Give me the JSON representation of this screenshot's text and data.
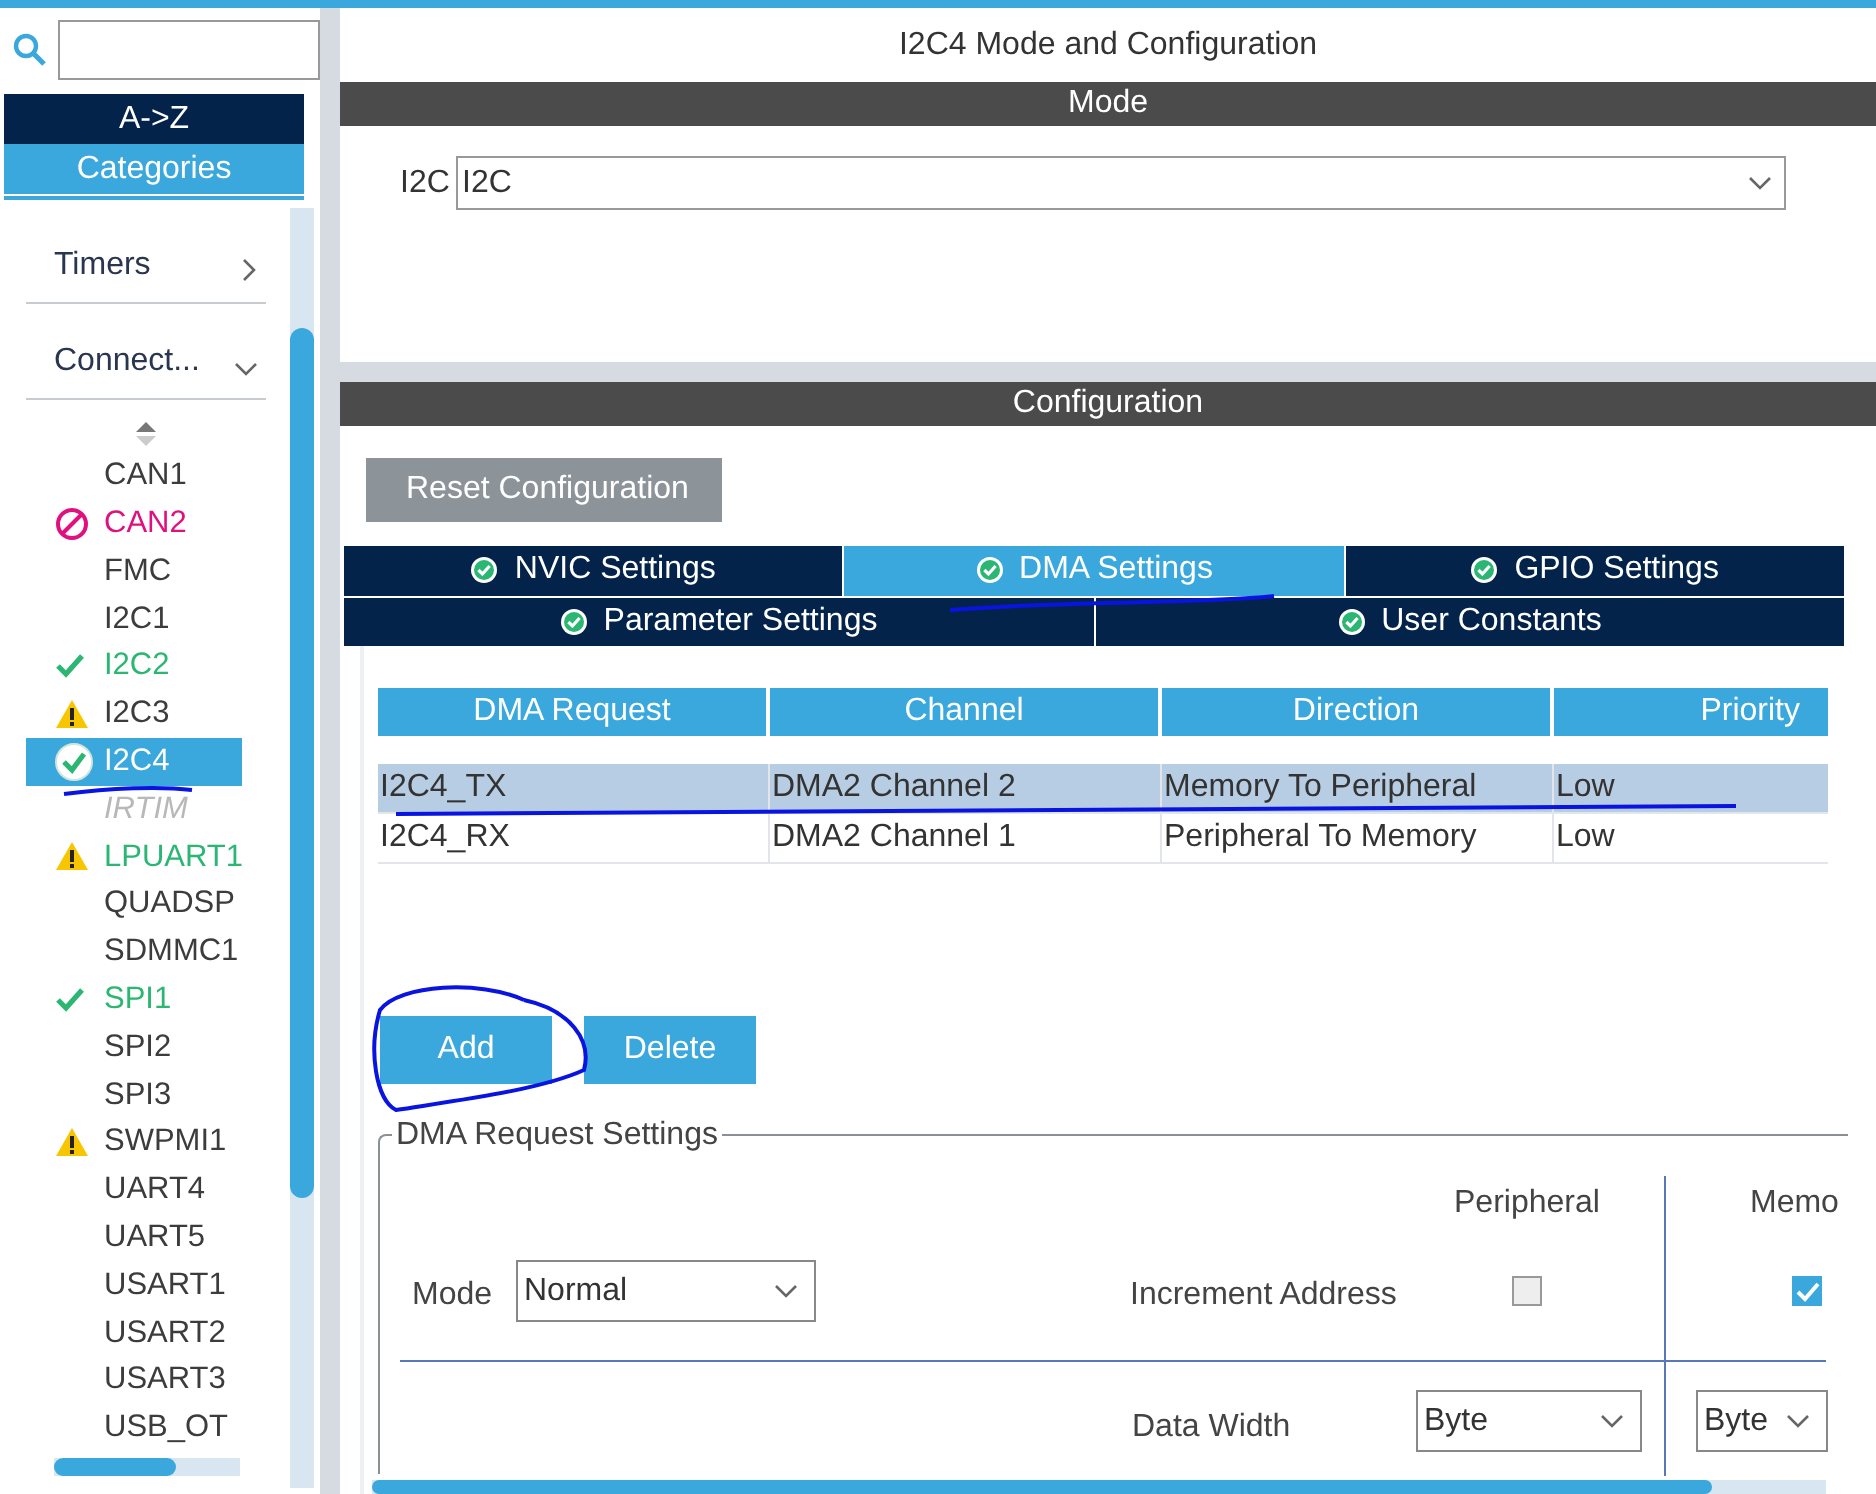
{
  "sidebar": {
    "sort_tabs": [
      {
        "label": "A->Z",
        "selected": false
      },
      {
        "label": "Categories",
        "selected": true
      }
    ],
    "categories": [
      {
        "label": "Timers",
        "expanded": false
      },
      {
        "label": "Connect...",
        "expanded": true
      }
    ],
    "peripherals": [
      {
        "label": "CAN1",
        "kind": "none",
        "color": "#3c3c3c",
        "selected": false,
        "disabled": false
      },
      {
        "label": "CAN2",
        "kind": "error",
        "color": "#e0107e",
        "selected": false,
        "disabled": false
      },
      {
        "label": "FMC",
        "kind": "none",
        "color": "#3c3c3c",
        "selected": false,
        "disabled": false
      },
      {
        "label": "I2C1",
        "kind": "none",
        "color": "#3c3c3c",
        "selected": false,
        "disabled": false
      },
      {
        "label": "I2C2",
        "kind": "ok",
        "color": "#2bb673",
        "selected": false,
        "disabled": false
      },
      {
        "label": "I2C3",
        "kind": "warning",
        "color": "#3c3c3c",
        "selected": false,
        "disabled": false
      },
      {
        "label": "I2C4",
        "kind": "ok",
        "color": "#ffffff",
        "selected": true,
        "disabled": false
      },
      {
        "label": "IRTIM",
        "kind": "none",
        "color": "#b8b8b8",
        "selected": false,
        "disabled": true
      },
      {
        "label": "LPUART1",
        "kind": "warning",
        "color": "#2bb673",
        "selected": false,
        "disabled": false
      },
      {
        "label": "QUADSP",
        "kind": "none",
        "color": "#3c3c3c",
        "selected": false,
        "disabled": false
      },
      {
        "label": "SDMMC1",
        "kind": "none",
        "color": "#3c3c3c",
        "selected": false,
        "disabled": false
      },
      {
        "label": "SPI1",
        "kind": "ok",
        "color": "#2bb673",
        "selected": false,
        "disabled": false
      },
      {
        "label": "SPI2",
        "kind": "none",
        "color": "#3c3c3c",
        "selected": false,
        "disabled": false
      },
      {
        "label": "SPI3",
        "kind": "none",
        "color": "#3c3c3c",
        "selected": false,
        "disabled": false
      },
      {
        "label": "SWPMI1",
        "kind": "warning",
        "color": "#3c3c3c",
        "selected": false,
        "disabled": false
      },
      {
        "label": "UART4",
        "kind": "none",
        "color": "#3c3c3c",
        "selected": false,
        "disabled": false
      },
      {
        "label": "UART5",
        "kind": "none",
        "color": "#3c3c3c",
        "selected": false,
        "disabled": false
      },
      {
        "label": "USART1",
        "kind": "none",
        "color": "#3c3c3c",
        "selected": false,
        "disabled": false
      },
      {
        "label": "USART2",
        "kind": "none",
        "color": "#3c3c3c",
        "selected": false,
        "disabled": false
      },
      {
        "label": "USART3",
        "kind": "none",
        "color": "#3c3c3c",
        "selected": false,
        "disabled": false
      },
      {
        "label": "USB_OT",
        "kind": "none",
        "color": "#3c3c3c",
        "selected": false,
        "disabled": false
      }
    ]
  },
  "title": "I2C4 Mode and Configuration",
  "mode": {
    "heading": "Mode",
    "label": "I2C",
    "value": "I2C"
  },
  "configuration": {
    "heading": "Configuration",
    "reset_button": "Reset Configuration",
    "tabs": [
      [
        {
          "label": "NVIC Settings",
          "selected": false
        },
        {
          "label": "DMA Settings",
          "selected": true
        },
        {
          "label": "GPIO Settings",
          "selected": false
        }
      ],
      [
        {
          "label": "Parameter Settings",
          "selected": false
        },
        {
          "label": "User Constants",
          "selected": false
        }
      ]
    ],
    "table": {
      "columns": [
        "DMA Request",
        "Channel",
        "Direction",
        "Priority"
      ],
      "rows": [
        {
          "cells": [
            "I2C4_TX",
            "DMA2 Channel 2",
            "Memory To Peripheral",
            "Low"
          ],
          "selected": true
        },
        {
          "cells": [
            "I2C4_RX",
            "DMA2 Channel 1",
            "Peripheral To Memory",
            "Low"
          ],
          "selected": false
        }
      ]
    },
    "buttons": [
      "Add",
      "Delete"
    ],
    "request_settings": {
      "title": "DMA Request Settings",
      "mode_label": "Mode",
      "mode_value": "Normal",
      "peripheral_heading": "Peripheral",
      "memory_heading": "Memo",
      "increment_label": "Increment Address",
      "peripheral_increment": {
        "checked": false
      },
      "memory_increment": {
        "checked": true
      },
      "data_width_label": "Data Width",
      "peripheral_width": "Byte",
      "memory_width": "Byte"
    }
  }
}
